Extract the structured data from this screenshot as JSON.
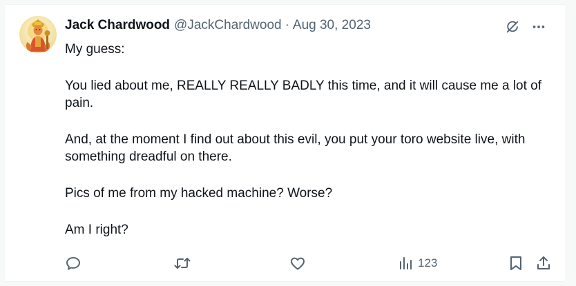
{
  "tweet": {
    "display_name": "Jack Chardwood",
    "handle": "@JackChardwood",
    "separator": "·",
    "date": "Aug 30, 2023",
    "paragraphs": [
      "My guess:",
      "You lied about me, REALLY REALLY BADLY this time, and it will cause me a lot of pain.",
      "And, at the moment I find out about this evil, you put your toro website live, with something dreadful on there.",
      "Pics of me from my hacked machine? Worse?",
      "Am I right?"
    ],
    "views": "123"
  },
  "icons": {
    "top": [
      "grok-icon",
      "more-icon"
    ],
    "actions": [
      "reply-icon",
      "retweet-icon",
      "like-icon",
      "views-icon",
      "bookmark-icon",
      "share-icon"
    ]
  },
  "colors": {
    "text_primary": "#0f1419",
    "text_secondary": "#536471",
    "background": "#ffffff",
    "page_background": "#f7f9f9"
  }
}
